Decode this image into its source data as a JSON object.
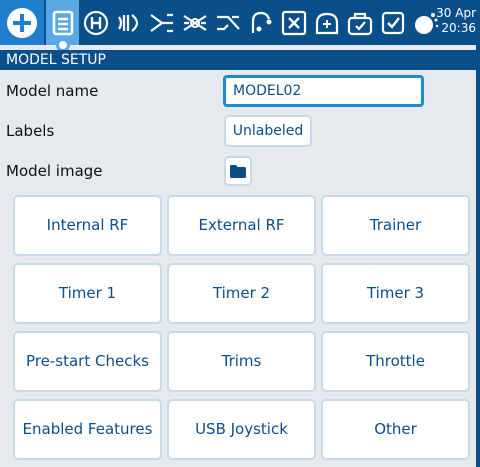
{
  "topbar": {
    "tabs": [
      {
        "icon": "model-list-icon",
        "active": true
      },
      {
        "icon": "heli-icon"
      },
      {
        "icon": "flight-modes-icon"
      },
      {
        "icon": "inputs-icon"
      },
      {
        "icon": "mixes-icon"
      },
      {
        "icon": "outputs-icon"
      },
      {
        "icon": "curves-icon"
      },
      {
        "icon": "global-variables-icon"
      },
      {
        "icon": "logical-switches-icon"
      },
      {
        "icon": "special-functions-icon"
      },
      {
        "icon": "checklist-icon"
      },
      {
        "icon": "telemetry-icon"
      }
    ],
    "date": "30 Apr",
    "time": "20:36"
  },
  "title": "MODEL SETUP",
  "form": {
    "model_name_label": "Model name",
    "model_name_value": "MODEL02",
    "labels_label": "Labels",
    "labels_value": "Unlabeled",
    "model_image_label": "Model image",
    "model_image_icon": "folder-icon"
  },
  "buttons": [
    "Internal RF",
    "External RF",
    "Trainer",
    "Timer 1",
    "Timer 2",
    "Timer 3",
    "Pre-start Checks",
    "Trims",
    "Throttle",
    "Enabled Features",
    "USB Joystick",
    "Other"
  ],
  "colors": {
    "topbar": "#0b4f8a",
    "accent": "#1f7fcc",
    "text_blue": "#0b4f8a",
    "background": "#e6e9ee"
  }
}
